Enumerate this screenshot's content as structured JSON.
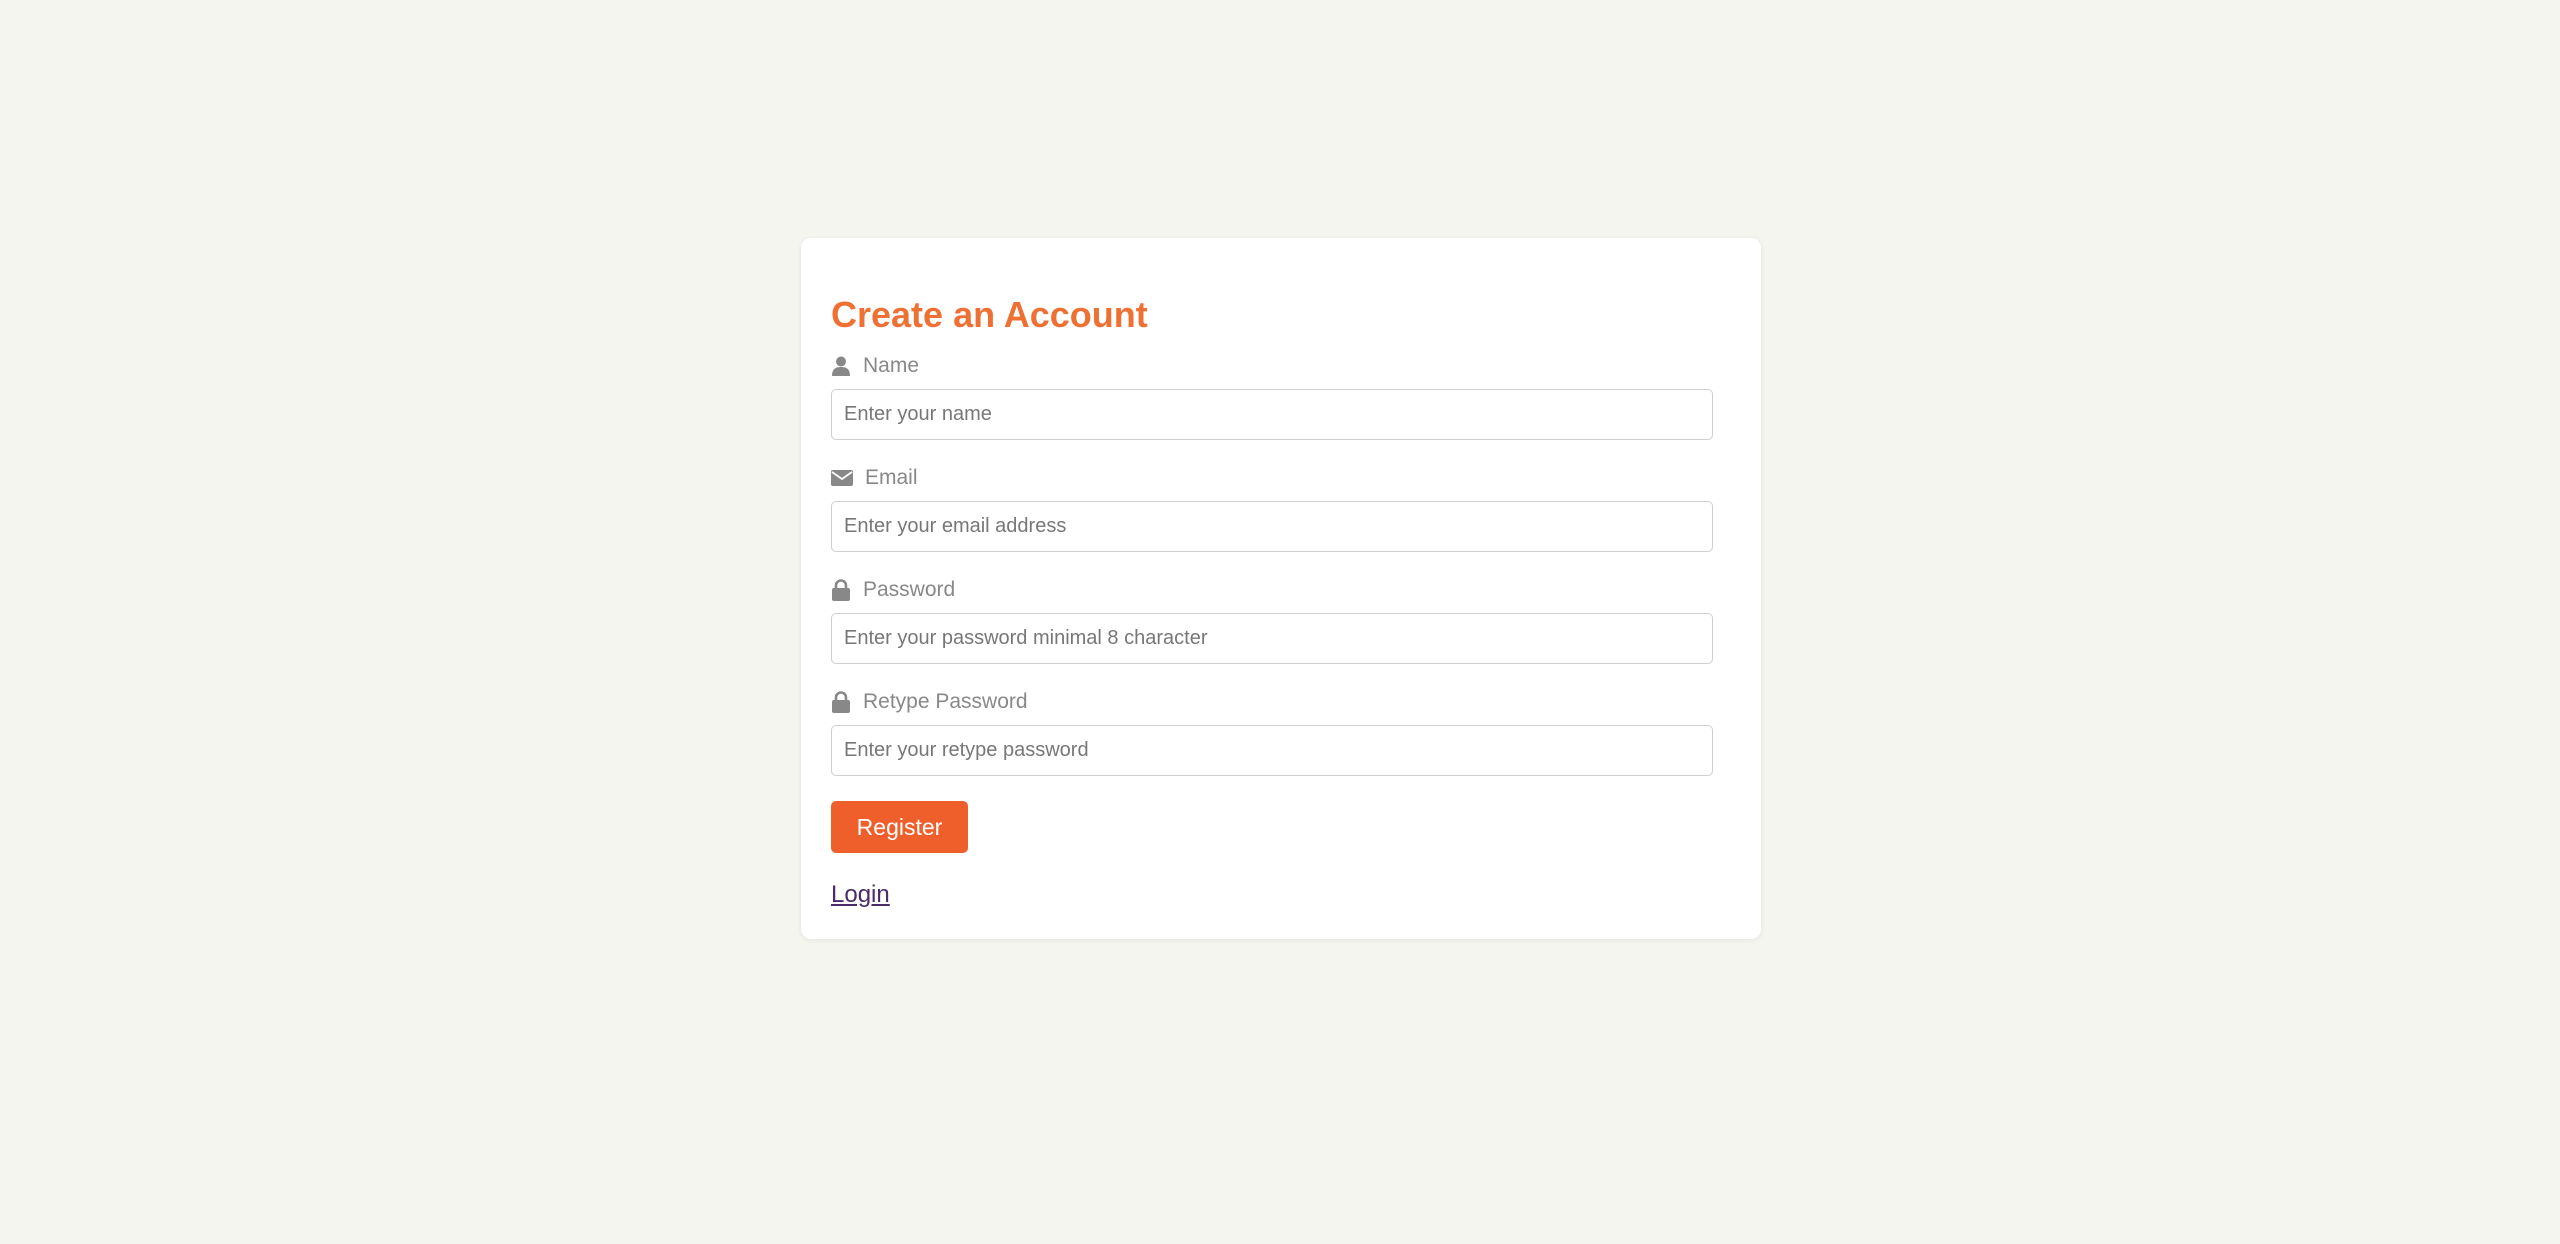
{
  "form": {
    "title": "Create an Account",
    "fields": [
      {
        "label": "Name",
        "icon": "user-icon",
        "placeholder": "Enter your name",
        "value": ""
      },
      {
        "label": "Email",
        "icon": "envelope-icon",
        "placeholder": "Enter your email address",
        "value": ""
      },
      {
        "label": "Password",
        "icon": "lock-icon",
        "placeholder": "Enter your password minimal 8 character",
        "value": ""
      },
      {
        "label": "Retype Password",
        "icon": "lock-icon",
        "placeholder": "Enter your retype password",
        "value": ""
      }
    ],
    "register_label": "Register",
    "login_label": "Login"
  },
  "colors": {
    "background": "#f5f5f0",
    "title": "#ee7033",
    "button": "#ef5f2b",
    "label": "#888888",
    "link": "#4a2a6a"
  }
}
